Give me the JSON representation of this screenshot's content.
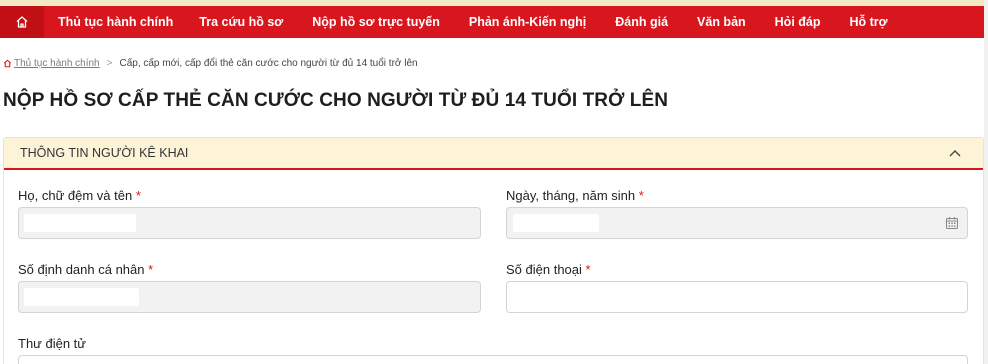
{
  "nav": {
    "home_icon": "home-icon",
    "items": [
      {
        "label": "Thủ tục hành chính"
      },
      {
        "label": "Tra cứu hồ sơ"
      },
      {
        "label": "Nộp hồ sơ trực tuyến"
      },
      {
        "label": "Phản ánh-Kiến nghị"
      },
      {
        "label": "Đánh giá"
      },
      {
        "label": "Văn bản"
      },
      {
        "label": "Hỏi đáp"
      },
      {
        "label": "Hỗ trợ"
      }
    ]
  },
  "breadcrumb": {
    "home_label": "Thủ tục hành chính",
    "current": "Cấp, cấp mới, cấp đổi thẻ căn cước cho người từ đủ 14 tuổi trở lên"
  },
  "page": {
    "title": "NỘP HỒ SƠ CẤP THẺ CĂN CƯỚC CHO NGƯỜI TỪ ĐỦ 14 TUỔI TRỞ LÊN"
  },
  "section": {
    "title": "THÔNG TIN NGƯỜI KÊ KHAI",
    "fields": {
      "full_name": {
        "label": "Họ, chữ đệm và tên",
        "required": "*"
      },
      "dob": {
        "label": "Ngày, tháng, năm sinh",
        "required": "*"
      },
      "id_number": {
        "label": "Số định danh cá nhân",
        "required": "*"
      },
      "phone": {
        "label": "Số điện thoại",
        "required": "*"
      },
      "email": {
        "label": "Thư điện tử"
      }
    }
  },
  "colors": {
    "nav_bg": "#d7161d",
    "header_bg": "#fdf4d8",
    "required": "#d7161d"
  }
}
